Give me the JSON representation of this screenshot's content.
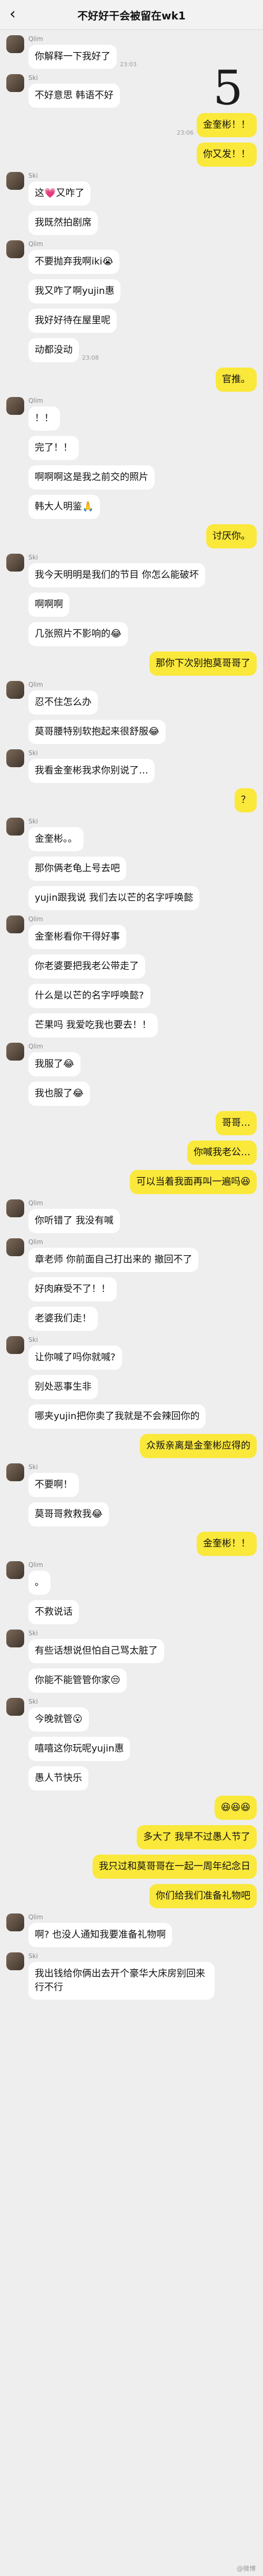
{
  "header": {
    "back_icon": "‹",
    "title": "不好好干会被留在wk1"
  },
  "handwritten": {
    "mark": "5"
  },
  "messages": [
    {
      "side": "left",
      "sender": "Qlim",
      "text": "你解释一下我好了",
      "time": "23:03"
    },
    {
      "side": "left",
      "sender": "Ski",
      "text": "不好意思 韩语不好",
      "time": ""
    },
    {
      "side": "right",
      "sender": "",
      "text": "金奎彬！！",
      "time": "23:06"
    },
    {
      "side": "right",
      "sender": "",
      "text": "你又发！！",
      "time": ""
    },
    {
      "side": "left",
      "sender": "Ski",
      "text": "这💗又咋了",
      "time": ""
    },
    {
      "side": "left",
      "sender": "",
      "text": "我既然拍剧席",
      "time": ""
    },
    {
      "side": "left",
      "sender": "Qlim",
      "text": "不要抛弃我啊iki😭",
      "time": ""
    },
    {
      "side": "left",
      "sender": "",
      "text": "我又咋了啊yujin惠",
      "time": ""
    },
    {
      "side": "left",
      "sender": "",
      "text": "我好好待在屋里呢",
      "time": ""
    },
    {
      "side": "left",
      "sender": "",
      "text": "动都没动",
      "time": "23:08"
    },
    {
      "side": "right",
      "sender": "",
      "text": "官推。",
      "time": ""
    },
    {
      "side": "left",
      "sender": "Qlim",
      "text": "！！",
      "time": ""
    },
    {
      "side": "left",
      "sender": "",
      "text": "完了！！",
      "time": ""
    },
    {
      "side": "left",
      "sender": "",
      "text": "啊啊啊这是我之前交的照片",
      "time": ""
    },
    {
      "side": "left",
      "sender": "",
      "text": "韩大人明鉴🙏",
      "time": ""
    },
    {
      "side": "right",
      "sender": "",
      "text": "讨厌你。",
      "time": ""
    },
    {
      "side": "left",
      "sender": "Ski",
      "text": "我今天明明是我们的节目 你怎么能破坏",
      "time": ""
    },
    {
      "side": "left",
      "sender": "",
      "text": "啊啊啊",
      "time": ""
    },
    {
      "side": "left",
      "sender": "",
      "text": "几张照片不影响的😂",
      "time": ""
    },
    {
      "side": "right",
      "sender": "",
      "text": "那你下次别抱莫哥哥了",
      "time": ""
    },
    {
      "side": "left",
      "sender": "Qlim",
      "text": "忍不住怎么办",
      "time": ""
    },
    {
      "side": "left",
      "sender": "",
      "text": "莫哥腰特别软抱起来很舒服😂",
      "time": ""
    },
    {
      "side": "left",
      "sender": "Ski",
      "text": "我看金奎彬我求你别说了…",
      "time": ""
    },
    {
      "side": "right",
      "sender": "",
      "text": "？",
      "time": ""
    },
    {
      "side": "left",
      "sender": "Ski",
      "text": "金奎彬。。",
      "time": ""
    },
    {
      "side": "left",
      "sender": "",
      "text": "那你俩老龟上号去吧",
      "time": ""
    },
    {
      "side": "left",
      "sender": "",
      "text": "yujin跟我说 我们去以芒的名字呼唤懿",
      "time": ""
    },
    {
      "side": "left",
      "sender": "Qlim",
      "text": "金奎彬看你干得好事",
      "time": ""
    },
    {
      "side": "left",
      "sender": "",
      "text": "你老婆要把我老公带走了",
      "time": ""
    },
    {
      "side": "left",
      "sender": "",
      "text": "什么是以芒的名字呼唤懿?",
      "time": ""
    },
    {
      "side": "left",
      "sender": "",
      "text": "芒果吗 我爱吃我也要去！！",
      "time": ""
    },
    {
      "side": "left",
      "sender": "Qlim",
      "text": "我服了😂",
      "time": ""
    },
    {
      "side": "left",
      "sender": "",
      "text": "我也服了😂",
      "time": ""
    },
    {
      "side": "right",
      "sender": "",
      "text": "哥哥…",
      "time": ""
    },
    {
      "side": "right",
      "sender": "",
      "text": "你喊我老公…",
      "time": ""
    },
    {
      "side": "right",
      "sender": "",
      "text": "可以当着我面再叫一遍吗😆",
      "time": ""
    },
    {
      "side": "left",
      "sender": "Qlim",
      "text": "你听错了 我没有喊",
      "time": ""
    },
    {
      "side": "left",
      "sender": "Qlim",
      "text": "章老师 你前面自己打出来的 撤回不了",
      "time": ""
    },
    {
      "side": "left",
      "sender": "",
      "text": "好肉麻受不了！！",
      "time": ""
    },
    {
      "side": "left",
      "sender": "",
      "text": "老婆我们走！",
      "time": ""
    },
    {
      "side": "left",
      "sender": "Ski",
      "text": "让你喊了吗你就喊?",
      "time": ""
    },
    {
      "side": "left",
      "sender": "",
      "text": "别处恶事生非",
      "time": ""
    },
    {
      "side": "left",
      "sender": "",
      "text": "哪夹yujin把你卖了我就是不会辣回你的",
      "time": ""
    },
    {
      "side": "right",
      "sender": "",
      "text": "众叛亲离是金奎彬应得的",
      "time": ""
    },
    {
      "side": "left",
      "sender": "Ski",
      "text": "不要啊！",
      "time": ""
    },
    {
      "side": "left",
      "sender": "",
      "text": "莫哥哥救救我😂",
      "time": ""
    },
    {
      "side": "right",
      "sender": "",
      "text": "金奎彬！！",
      "time": ""
    },
    {
      "side": "left",
      "sender": "Qlim",
      "text": "。",
      "time": ""
    },
    {
      "side": "left",
      "sender": "",
      "text": "不救说话",
      "time": ""
    },
    {
      "side": "left",
      "sender": "Ski",
      "text": "有些话想说但怕自己骂太脏了",
      "time": ""
    },
    {
      "side": "left",
      "sender": "",
      "text": "你能不能管管你家😒",
      "time": ""
    },
    {
      "side": "left",
      "sender": "Ski",
      "text": "今晚就管😮",
      "time": ""
    },
    {
      "side": "left",
      "sender": "",
      "text": "嘻嘻这你玩呢yujin惠",
      "time": ""
    },
    {
      "side": "left",
      "sender": "",
      "text": "愚人节快乐",
      "time": ""
    },
    {
      "side": "right",
      "sender": "",
      "text": "😆😆😆",
      "time": ""
    },
    {
      "side": "right",
      "sender": "",
      "text": "多大了 我早不过愚人节了",
      "time": ""
    },
    {
      "side": "right",
      "sender": "",
      "text": "我只过和莫哥哥在一起一周年纪念日",
      "time": ""
    },
    {
      "side": "right",
      "sender": "",
      "text": "你们给我们准备礼物吧",
      "time": ""
    },
    {
      "side": "left",
      "sender": "Qlim",
      "text": "啊? 也没人通知我要准备礼物啊",
      "time": ""
    },
    {
      "side": "left",
      "sender": "Ski",
      "text": "我出钱给你俩出去开个豪华大床房别回来行不行",
      "time": ""
    }
  ],
  "watermark": "@微博"
}
